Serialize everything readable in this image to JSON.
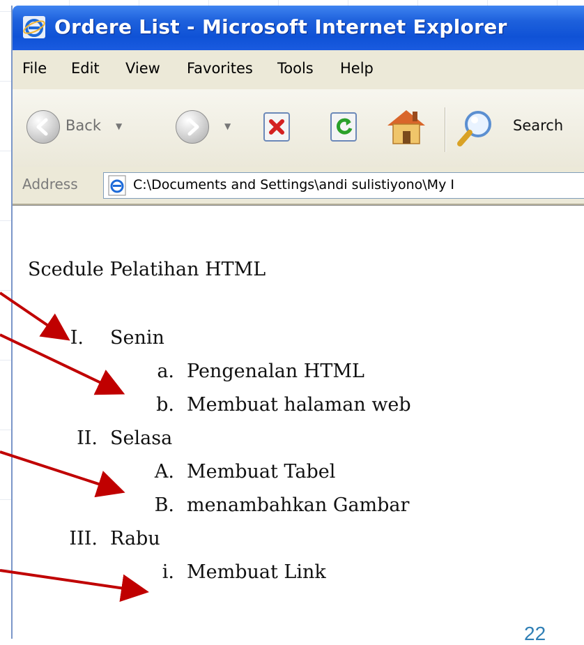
{
  "window": {
    "title": "Ordere List - Microsoft Internet Explorer"
  },
  "menu": {
    "items": [
      "File",
      "Edit",
      "View",
      "Favorites",
      "Tools",
      "Help"
    ]
  },
  "toolbar": {
    "back_label": "Back",
    "search_label": "Search",
    "icons": [
      "back-icon",
      "forward-icon",
      "stop-icon",
      "refresh-icon",
      "home-icon",
      "search-icon"
    ]
  },
  "address": {
    "label": "Address",
    "value": "C:\\Documents and Settings\\andi sulistiyono\\My I"
  },
  "page": {
    "heading": "Scedule Pelatihan HTML",
    "list": [
      {
        "marker": "I.",
        "text": "Senin",
        "level": 1
      },
      {
        "marker": "a.",
        "text": "Pengenalan HTML",
        "level": 2
      },
      {
        "marker": "b.",
        "text": "Membuat halaman web",
        "level": 2
      },
      {
        "marker": "II.",
        "text": "Selasa",
        "level": 1
      },
      {
        "marker": "A.",
        "text": "Membuat Tabel",
        "level": 2
      },
      {
        "marker": "B.",
        "text": "menambahkan Gambar",
        "level": 2
      },
      {
        "marker": "III.",
        "text": "Rabu",
        "level": 1
      },
      {
        "marker": "i.",
        "text": "Membuat Link",
        "level": 2
      }
    ]
  },
  "slide": {
    "number": "22",
    "arrow_color": "#c00000"
  },
  "colors": {
    "titlebar": "#0f52d6",
    "chrome": "#ece9d8"
  }
}
